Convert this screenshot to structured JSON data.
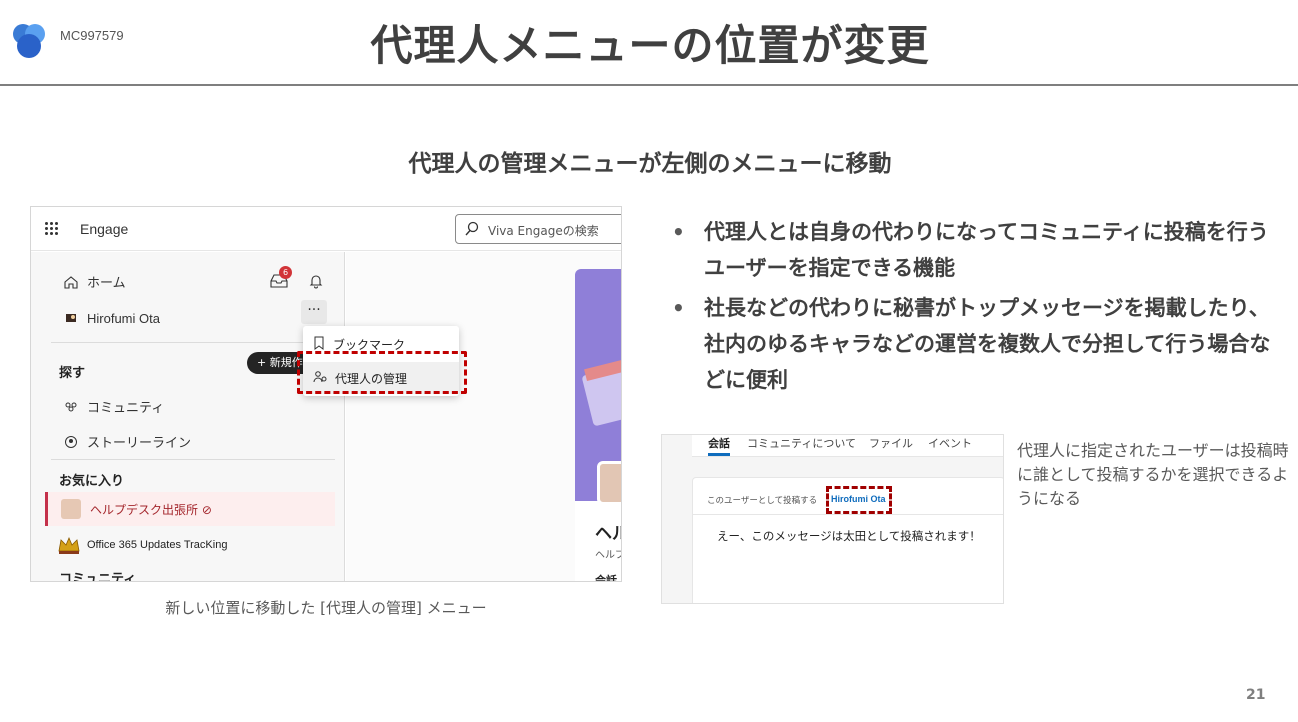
{
  "slide": {
    "message_id": "MC997579",
    "title": "代理人メニューの位置が変更",
    "subtitle": "代理人の管理メニューが左側のメニューに移動",
    "page_number": "21"
  },
  "engage_screenshot": {
    "app_name": "Engage",
    "search_placeholder": "Viva Engageの検索",
    "nav": {
      "home_label": "ホーム",
      "user_name": "Hirofumi Ota",
      "notification_count": "6",
      "more_label": "···"
    },
    "explore_section": {
      "heading": "探す",
      "new_button_label": "+ 新規作",
      "items": [
        {
          "label": "コミュニティ",
          "icon": "people-icon"
        },
        {
          "label": "ストーリーライン",
          "icon": "storyline-icon"
        }
      ]
    },
    "favorites_section": {
      "heading": "お気に入り",
      "items": [
        {
          "label": "ヘルプデスク出張所 ⊘"
        },
        {
          "label": "Office 365 Updates TracKing"
        }
      ]
    },
    "community_heading": "コミュニティ",
    "dropdown_menu": {
      "items": [
        {
          "label": "ブックマーク",
          "icon": "bookmark-icon"
        },
        {
          "label": "代理人の管理",
          "icon": "delegate-icon"
        }
      ]
    },
    "card": {
      "title_partial": "ヘル",
      "subtitle_partial": "ヘルプ",
      "tab_partial": "会話"
    }
  },
  "caption_left": "新しい位置に移動した [代理人の管理] メニュー",
  "bullets": [
    "代理人とは自身の代わりになってコミュニティに投稿を行うユーザーを指定できる機能",
    "社長などの代わりに秘書がトップメッセージを掲載したり、社内のゆるキャラなどの運営を複数人で分担して行う場合などに便利"
  ],
  "post_screenshot": {
    "tabs": [
      "会話",
      "コミュニティについて",
      "ファイル",
      "イベント"
    ],
    "post_as_label": "このユーザーとして投稿する",
    "post_as_user": "Hirofumi Ota",
    "message": "えー、このメッセージは太田として投稿されます！"
  },
  "caption_right": "代理人に指定されたユーザーは投稿時に誰として投稿するかを選択できるようになる",
  "colors": {
    "highlight_dash": "#c00000",
    "title_text": "#404040",
    "link_blue": "#0f6cbd",
    "badge_red": "#d13438"
  }
}
